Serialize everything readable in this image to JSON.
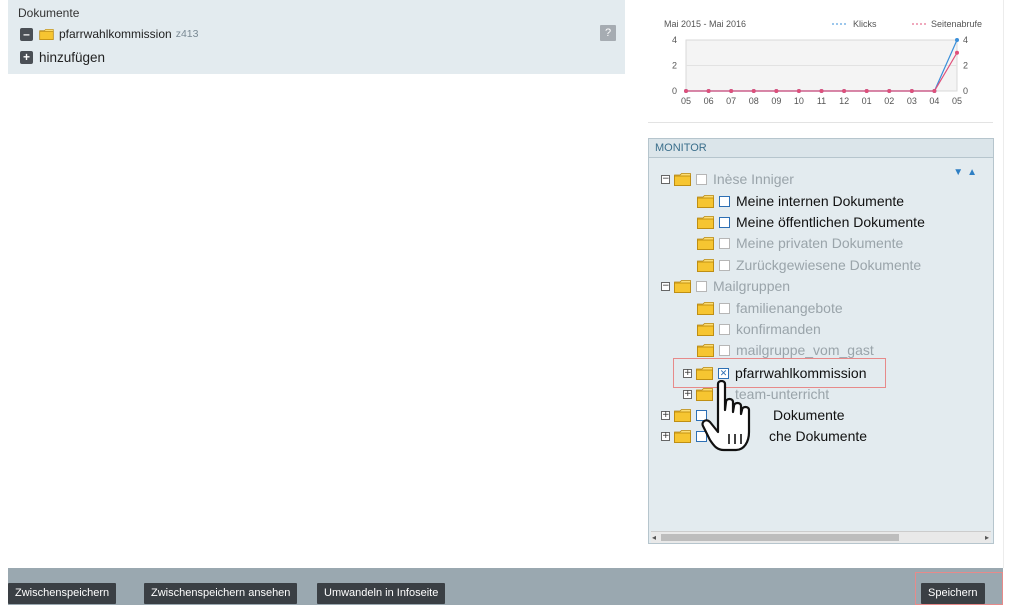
{
  "documents": {
    "title": "Dokumente",
    "item_name": "pfarrwahlkommission",
    "item_code": "z413",
    "add_label": "hinzufügen",
    "help_label": "?"
  },
  "stats": {
    "period_label": "Mai 2015 - Mai 2016",
    "legend_clicks": "Klicks",
    "legend_pageviews": "Seitenabrufe"
  },
  "chart_data": {
    "type": "line",
    "title": "Mai 2015 - Mai 2016",
    "categories": [
      "05",
      "06",
      "07",
      "08",
      "09",
      "10",
      "11",
      "12",
      "01",
      "02",
      "03",
      "04",
      "05"
    ],
    "series": [
      {
        "name": "Klicks",
        "color": "#3a8fd9",
        "values": [
          0,
          0,
          0,
          0,
          0,
          0,
          0,
          0,
          0,
          0,
          0,
          0,
          4
        ]
      },
      {
        "name": "Seitenabrufe",
        "color": "#e0507a",
        "values": [
          0,
          0,
          0,
          0,
          0,
          0,
          0,
          0,
          0,
          0,
          0,
          0,
          3
        ]
      }
    ],
    "ylim": [
      0,
      4
    ],
    "yticks": [
      "4",
      "2",
      "0"
    ],
    "legend": "top-right"
  },
  "monitor": {
    "title": "MONITOR",
    "tree": [
      {
        "label": "Inèse Inniger"
      },
      {
        "label": "Meine internen Dokumente"
      },
      {
        "label": "Meine öffentlichen Dokumente"
      },
      {
        "label": "Meine privaten Dokumente"
      },
      {
        "label": "Zurückgewiesene Dokumente"
      },
      {
        "label": "Mailgruppen"
      },
      {
        "label": "familienangebote"
      },
      {
        "label": "konfirmanden"
      },
      {
        "label": "mailgruppe_vom_gast"
      },
      {
        "label": "pfarrwahlkommission"
      },
      {
        "label": "team-unterricht"
      },
      {
        "label": "Dokumente"
      },
      {
        "label": "che Dokumente"
      }
    ]
  },
  "toolbar": {
    "btn_save_draft": "Zwischenspeichern",
    "btn_view_draft": "Zwischenspeichern ansehen",
    "btn_convert": "Umwandeln in Infoseite",
    "btn_save": "Speichern"
  },
  "colors": {
    "panel_bg": "#e3ebef",
    "bar_bg": "#9aa8b0",
    "button_bg": "#3a3f44",
    "highlight": "#e78a8a",
    "link_blue": "#3b6f8c"
  }
}
